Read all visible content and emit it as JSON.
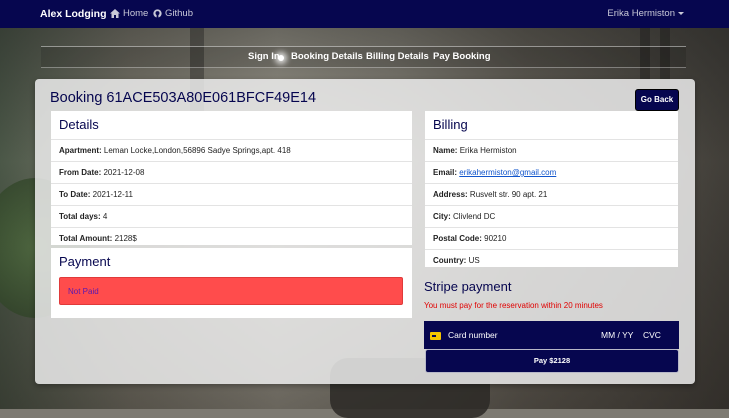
{
  "navbar": {
    "brand": "Alex Lodging",
    "home_label": "Home",
    "github_label": "Github",
    "user_name": "Erika Hermiston"
  },
  "steps": [
    "Sign In",
    "Booking Details",
    "Billing Details",
    "Pay Booking"
  ],
  "booking": {
    "title": "Booking 61ACE503A80E061BFCF49E14",
    "back_label": "Go Back"
  },
  "details": {
    "heading": "Details",
    "apartment_label": "Apartment:",
    "apartment_value": "Leman Locke,London,56896 Sadye Springs,apt. 418",
    "from_label": "From Date:",
    "from_value": "2021-12-08",
    "to_label": "To Date:",
    "to_value": "2021-12-11",
    "days_label": "Total days:",
    "days_value": "4",
    "amount_label": "Total Amount:",
    "amount_value": "2128$"
  },
  "payment": {
    "heading": "Payment",
    "status": "Not Paid"
  },
  "billing": {
    "heading": "Billing",
    "name_label": "Name:",
    "name_value": "Erika Hermiston",
    "email_label": "Email:",
    "email_value": "erikahermiston@gmail.com",
    "address_label": "Address:",
    "address_value": "Rusvelt str. 90 apt. 21",
    "city_label": "City:",
    "city_value": "Clivlend DC",
    "postal_label": "Postal Code:",
    "postal_value": "90210",
    "country_label": "Country:",
    "country_value": "US"
  },
  "stripe": {
    "heading": "Stripe payment",
    "warning": "You must pay for the reservation within 20 minutes",
    "card_number_placeholder": "Card number",
    "expiry_placeholder": "MM / YY",
    "cvc_placeholder": "CVC",
    "pay_label": "Pay $2128"
  },
  "colors": {
    "navy": "#06064f",
    "alert_red": "#ff4c4c",
    "warning_text": "#e00000"
  }
}
